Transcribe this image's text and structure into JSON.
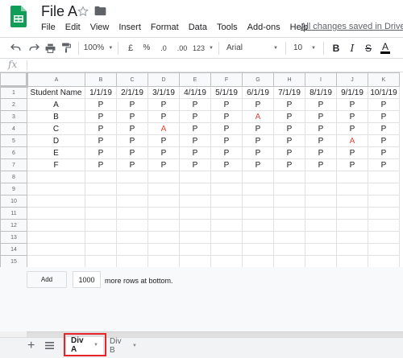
{
  "app": {
    "title": "File A",
    "saved_status": "All changes saved in Drive"
  },
  "menu": [
    "File",
    "Edit",
    "View",
    "Insert",
    "Format",
    "Data",
    "Tools",
    "Add-ons",
    "Help"
  ],
  "toolbar": {
    "zoom": "100%",
    "currency": "£",
    "percent": "%",
    "decrease_decimals": ".0",
    "increase_decimals": ".00",
    "more_formats": "123",
    "font": "Arial",
    "font_size": "10",
    "bold": "B",
    "italic": "I",
    "strike": "S",
    "text_color": "A"
  },
  "formula_bar": {
    "fx_label": "fx",
    "value": ""
  },
  "grid": {
    "columns": [
      "A",
      "B",
      "C",
      "D",
      "E",
      "F",
      "G",
      "H",
      "I",
      "J",
      "K"
    ],
    "row_numbers": [
      "1",
      "2",
      "3",
      "4",
      "5",
      "6",
      "7",
      "8",
      "9",
      "10",
      "11",
      "12",
      "13",
      "14",
      "15"
    ],
    "rows": [
      [
        "Student Name",
        "1/1/19",
        "2/1/19",
        "3/1/19",
        "4/1/19",
        "5/1/19",
        "6/1/19",
        "7/1/19",
        "8/1/19",
        "9/1/19",
        "10/1/19"
      ],
      [
        "A",
        "P",
        "P",
        "P",
        "P",
        "P",
        "P",
        "P",
        "P",
        "P",
        "P"
      ],
      [
        "B",
        "P",
        "P",
        "P",
        "P",
        "P",
        "A",
        "P",
        "P",
        "P",
        "P"
      ],
      [
        "C",
        "P",
        "P",
        "A",
        "P",
        "P",
        "P",
        "P",
        "P",
        "P",
        "P"
      ],
      [
        "D",
        "P",
        "P",
        "P",
        "P",
        "P",
        "P",
        "P",
        "P",
        "A",
        "P"
      ],
      [
        "E",
        "P",
        "P",
        "P",
        "P",
        "P",
        "P",
        "P",
        "P",
        "P",
        "P"
      ],
      [
        "F",
        "P",
        "P",
        "P",
        "P",
        "P",
        "P",
        "P",
        "P",
        "P",
        "P"
      ]
    ],
    "absent_color": "#ea4335"
  },
  "add_rows": {
    "button_label": "Add",
    "count": "1000",
    "suffix_text": "more rows at bottom."
  },
  "sheets": {
    "tabs": [
      {
        "label": "Div A",
        "active": true
      },
      {
        "label": "Div B",
        "active": false
      }
    ],
    "highlight_color": "#e8232a"
  }
}
